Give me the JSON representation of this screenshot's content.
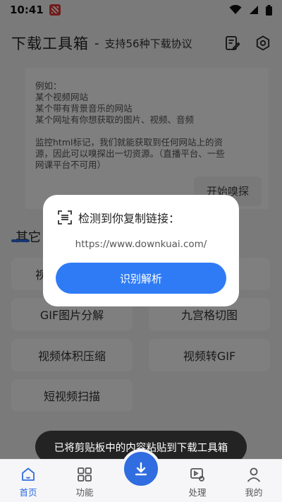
{
  "status_bar": {
    "time": "10:41"
  },
  "header": {
    "title": "下载工具箱",
    "separator": "-",
    "subtitle": "支持56种下载协议"
  },
  "sniff_card": {
    "text": "例如：\n某个视频网站\n某个带有背景音乐的网站\n某个网址有你想获取的图片、视频、音频\n\n监控html标记，我们就能获取到任何网站上的资\n源，因此可以嗅探出一切资源。（直播平台、一些\n网课平台不可用）",
    "button": "开始嗅探"
  },
  "section": {
    "title": "其它"
  },
  "tools": {
    "row1_left": "视",
    "gif_split": "GIF图片分解",
    "grid_cut": "九宫格切图",
    "video_compress": "视频体积压缩",
    "video_to_gif": "视频转GIF",
    "short_video_scan": "短视频扫描"
  },
  "dialog": {
    "title": "检测到你复制链接：",
    "url": "https://www.downkuai.com/",
    "button": "识别解析"
  },
  "toast": "已将剪贴板中的内容粘贴到下载工具箱",
  "nav": {
    "home": "首页",
    "features": "功能",
    "process": "处理",
    "mine": "我的"
  },
  "colors": {
    "accent": "#2f6de0",
    "dialog_button": "#2f7bf6"
  }
}
